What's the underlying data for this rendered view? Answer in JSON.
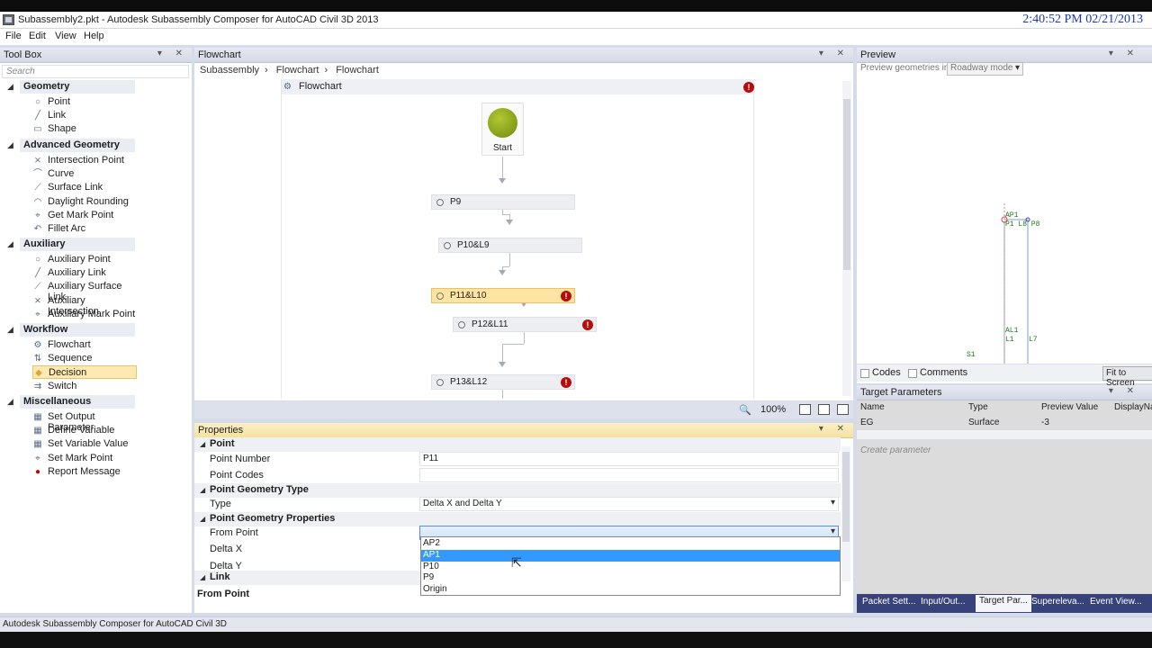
{
  "window": {
    "title": "Subassembly2.pkt - Autodesk Subassembly Composer for AutoCAD Civil 3D 2013",
    "clock": "2:40:52 PM 02/21/2013"
  },
  "menu": [
    "File",
    "Edit",
    "View",
    "Help"
  ],
  "toolbox": {
    "title": "Tool Box",
    "search_placeholder": "Search",
    "categories": [
      {
        "label": "Geometry",
        "items": [
          {
            "label": "Point",
            "icon": "point-icon"
          },
          {
            "label": "Link",
            "icon": "link-icon"
          },
          {
            "label": "Shape",
            "icon": "shape-icon"
          }
        ]
      },
      {
        "label": "Advanced Geometry",
        "items": [
          {
            "label": "Intersection Point",
            "icon": "intersection-point-icon"
          },
          {
            "label": "Curve",
            "icon": "curve-icon"
          },
          {
            "label": "Surface Link",
            "icon": "surface-link-icon"
          },
          {
            "label": "Daylight Rounding",
            "icon": "daylight-rounding-icon"
          },
          {
            "label": "Get Mark Point",
            "icon": "get-mark-point-icon"
          },
          {
            "label": "Fillet Arc",
            "icon": "fillet-arc-icon"
          }
        ]
      },
      {
        "label": "Auxiliary",
        "items": [
          {
            "label": "Auxiliary Point",
            "icon": "auxiliary-point-icon"
          },
          {
            "label": "Auxiliary Link",
            "icon": "auxiliary-link-icon"
          },
          {
            "label": "Auxiliary Surface Link",
            "icon": "auxiliary-surface-link-icon"
          },
          {
            "label": "Auxiliary Intersection",
            "icon": "auxiliary-intersection-icon"
          },
          {
            "label": "Auxiliary Mark Point",
            "icon": "auxiliary-mark-point-icon"
          }
        ]
      },
      {
        "label": "Workflow",
        "items": [
          {
            "label": "Flowchart",
            "icon": "flowchart-icon"
          },
          {
            "label": "Sequence",
            "icon": "sequence-icon"
          },
          {
            "label": "Decision",
            "icon": "decision-icon",
            "selected": true
          },
          {
            "label": "Switch",
            "icon": "switch-icon"
          }
        ]
      },
      {
        "label": "Miscellaneous",
        "items": [
          {
            "label": "Set Output Parameter",
            "icon": "set-output-parameter-icon"
          },
          {
            "label": "Define Variable",
            "icon": "define-variable-icon"
          },
          {
            "label": "Set Variable Value",
            "icon": "set-variable-value-icon"
          },
          {
            "label": "Set Mark Point",
            "icon": "set-mark-point-icon"
          },
          {
            "label": "Report Message",
            "icon": "report-message-icon"
          }
        ]
      }
    ]
  },
  "flowchart": {
    "title": "Flowchart",
    "breadcrumb": [
      "Subassembly",
      "Flowchart",
      "Flowchart"
    ],
    "canvas_title": "Flowchart",
    "start_label": "Start",
    "nodes": [
      {
        "label": "P9",
        "error": false,
        "active": false
      },
      {
        "label": "P10&L9",
        "error": false,
        "active": false
      },
      {
        "label": "P11&L10",
        "error": true,
        "active": true
      },
      {
        "label": "P12&L11",
        "error": true,
        "active": false
      },
      {
        "label": "P13&L12",
        "error": true,
        "active": false
      }
    ],
    "zoom": "100%"
  },
  "properties": {
    "title": "Properties",
    "sections": {
      "point": "Point",
      "geometry_type": "Point Geometry Type",
      "geometry_props": "Point Geometry Properties",
      "link": "Link"
    },
    "fields": {
      "point_number": {
        "label": "Point Number",
        "value": "P11"
      },
      "point_codes": {
        "label": "Point Codes",
        "value": ""
      },
      "type": {
        "label": "Type",
        "value": "Delta X and Delta Y"
      },
      "from_point": {
        "label": "From Point",
        "value": ""
      },
      "delta_x": {
        "label": "Delta X"
      },
      "delta_y": {
        "label": "Delta Y"
      }
    },
    "dropdown_options": [
      "AP2",
      "AP1",
      "P10",
      "P9",
      "Origin"
    ],
    "dropdown_selected": "AP1",
    "footer": "From Point"
  },
  "preview": {
    "title": "Preview",
    "mode_label": "Preview geometries in",
    "mode_value": "Roadway mode",
    "codes_label": "Codes",
    "comments_label": "Comments",
    "fit_button": "Fit to Screen",
    "labels": [
      "AP1",
      "P1 L8 P8",
      "AL1",
      "L1",
      "L7",
      "S1"
    ]
  },
  "target_parameters": {
    "title": "Target Parameters",
    "columns": [
      "Name",
      "Type",
      "Preview Value",
      "DisplayNa"
    ],
    "rows": [
      {
        "name": "EG",
        "type": "Surface",
        "preview_value": "-3",
        "display": ""
      }
    ],
    "create_placeholder": "Create parameter"
  },
  "bottom_tabs": [
    "Packet Sett...",
    "Input/Out...",
    "Target Par...",
    "Supereleva...",
    "Event View..."
  ],
  "bottom_tab_active": "Target Par...",
  "status": "Autodesk Subassembly Composer for AutoCAD Civil 3D",
  "colors": {
    "accent": "#3399ff",
    "error": "#b30d0d",
    "active_node": "#fde4a3",
    "tab_bar": "#37427a"
  }
}
